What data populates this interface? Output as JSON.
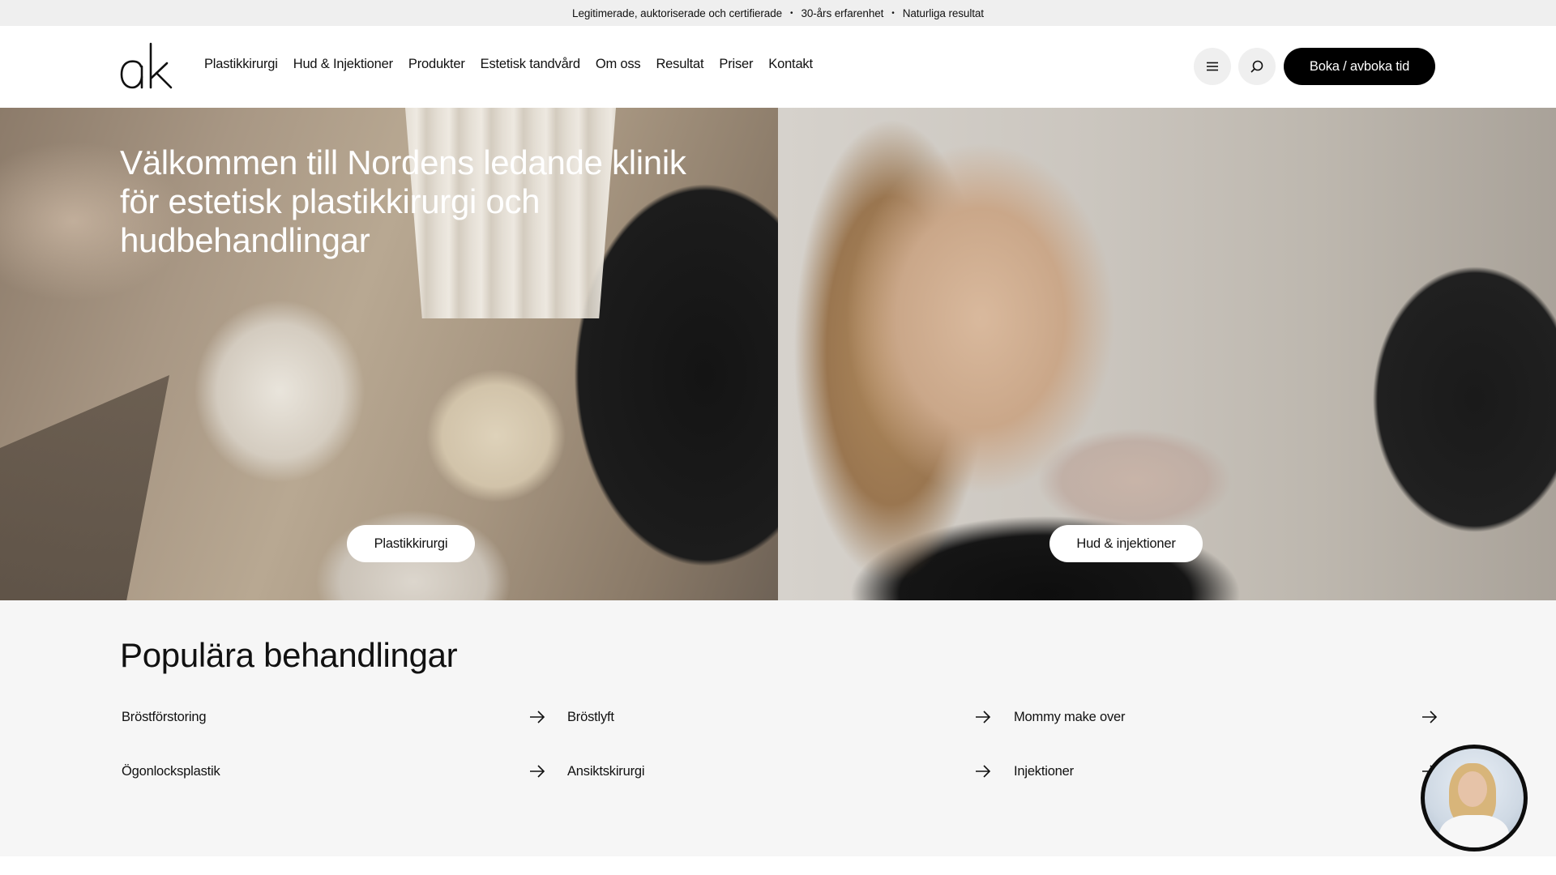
{
  "topbar": {
    "items": [
      "Legitimerade, auktoriserade och certifierade",
      "30-års erfarenhet",
      "Naturliga resultat"
    ],
    "separator": "•"
  },
  "header": {
    "logo_text": "ak",
    "nav": [
      "Plastikkirurgi",
      "Hud & Injektioner",
      "Produkter",
      "Estetisk tandvård",
      "Om oss",
      "Resultat",
      "Priser",
      "Kontakt"
    ],
    "menu_icon": "hamburger-icon",
    "search_icon": "search-icon",
    "book_label": "Boka / avboka tid"
  },
  "hero": {
    "title": "Välkommen till Nordens ledande klinik för estetisk plastikkirurgi och hudbehandlingar",
    "left_button": "Plastikkirurgi",
    "right_button": "Hud & injektioner"
  },
  "popular": {
    "heading": "Populära behandlingar",
    "arrow_icon": "arrow-right-icon",
    "items": [
      "Bröstförstoring",
      "Bröstlyft",
      "Mommy make over",
      "Ögonlocksplastik",
      "Ansiktskirurgi",
      "Injektioner"
    ]
  },
  "colors": {
    "topbar_bg": "#efefef",
    "primary_button": "#000000",
    "section_bg": "#f6f6f6"
  }
}
